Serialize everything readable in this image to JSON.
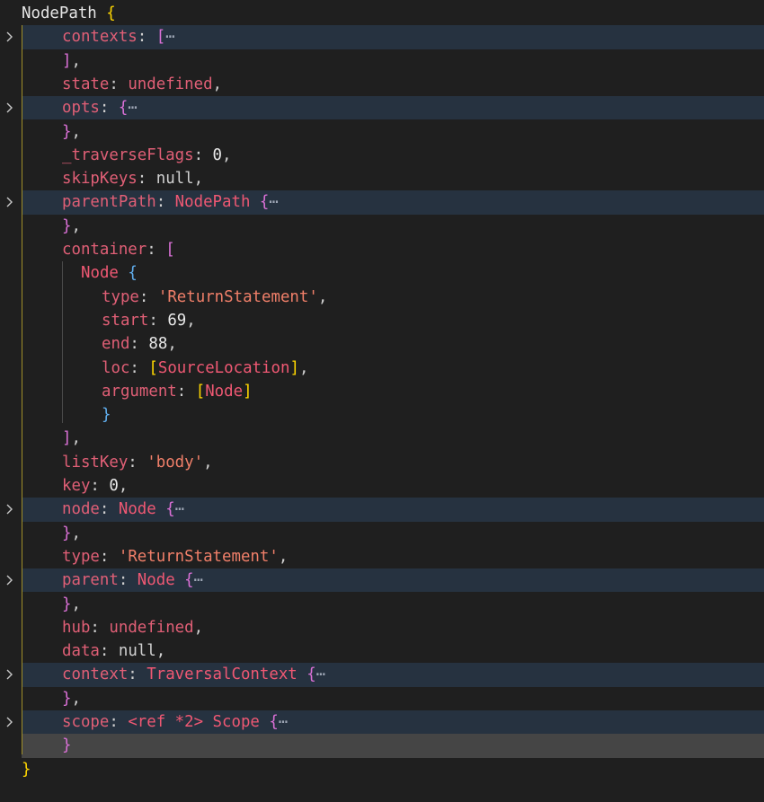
{
  "colors": {
    "background": "#1f1f1f",
    "fold_highlight": "#263240",
    "cursor_line": "#454545",
    "key": "#e05f76",
    "string": "#f07f69",
    "bracket_gold": "#ffd700",
    "bracket_purple": "#da70d6",
    "bracket_blue": "#61afef"
  },
  "lines": [
    {
      "kind": "header",
      "text": "NodePath",
      "bracket": "{"
    },
    {
      "kind": "fold",
      "key": "contexts",
      "bracket": "["
    },
    {
      "kind": "close",
      "text": "],"
    },
    {
      "kind": "kv",
      "key": "state",
      "value": "undefined",
      "tail": ","
    },
    {
      "kind": "fold",
      "key": "opts",
      "bracket": "{"
    },
    {
      "kind": "close",
      "text": "},"
    },
    {
      "kind": "kv",
      "key": "_traverseFlags",
      "value": "0",
      "tail": ","
    },
    {
      "kind": "kv",
      "key": "skipKeys",
      "value": "null",
      "tail": ","
    },
    {
      "kind": "fold",
      "key": "parentPath",
      "cls": "NodePath",
      "bracket": "{"
    },
    {
      "kind": "close",
      "text": "},"
    },
    {
      "kind": "open",
      "key": "container",
      "bracket": "["
    },
    {
      "kind": "nested_open",
      "cls": "Node",
      "bracket": "{"
    },
    {
      "kind": "nested_kv",
      "key": "type",
      "value": "'ReturnStatement'",
      "tail": ","
    },
    {
      "kind": "nested_kv",
      "key": "start",
      "value": "69",
      "tail": ","
    },
    {
      "kind": "nested_kv",
      "key": "end",
      "value": "88",
      "tail": ","
    },
    {
      "kind": "nested_ref",
      "key": "loc",
      "value": "SourceLocation",
      "tail": ","
    },
    {
      "kind": "nested_ref",
      "key": "argument",
      "value": "Node",
      "tail": ""
    },
    {
      "kind": "nested_close",
      "text": "}"
    },
    {
      "kind": "close",
      "text": "],"
    },
    {
      "kind": "kv",
      "key": "listKey",
      "value": "'body'",
      "tail": ","
    },
    {
      "kind": "kv",
      "key": "key",
      "value": "0",
      "tail": ","
    },
    {
      "kind": "fold",
      "key": "node",
      "cls": "Node",
      "bracket": "{"
    },
    {
      "kind": "close",
      "text": "},"
    },
    {
      "kind": "kv",
      "key": "type",
      "value": "'ReturnStatement'",
      "tail": ","
    },
    {
      "kind": "fold",
      "key": "parent",
      "cls": "Node",
      "bracket": "{"
    },
    {
      "kind": "close",
      "text": "},"
    },
    {
      "kind": "kv",
      "key": "hub",
      "value": "undefined",
      "tail": ","
    },
    {
      "kind": "kv",
      "key": "data",
      "value": "null",
      "tail": ","
    },
    {
      "kind": "fold",
      "key": "context",
      "cls": "TraversalContext",
      "bracket": "{"
    },
    {
      "kind": "close",
      "text": "},"
    },
    {
      "kind": "fold",
      "key": "scope",
      "cls": "<ref *2> Scope",
      "bracket": "{"
    },
    {
      "kind": "close_cursor",
      "text": "}"
    },
    {
      "kind": "footer",
      "text": "}"
    }
  ],
  "fold_marker": "⋯"
}
